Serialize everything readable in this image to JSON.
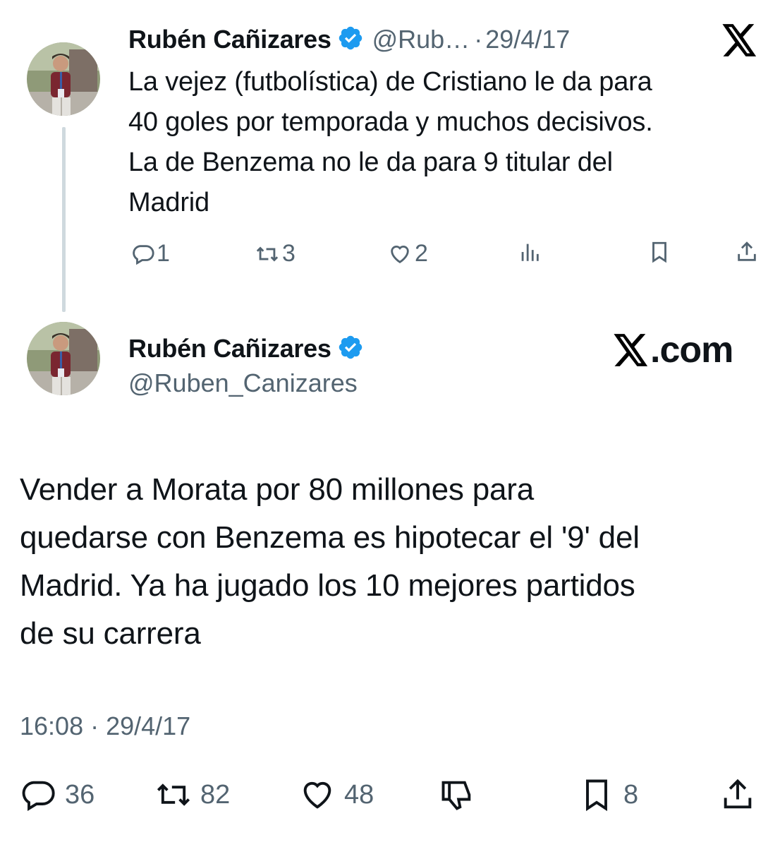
{
  "reply_tweet": {
    "author_name": "Rubén Cañizares",
    "handle_truncated": "@Rub…",
    "separator": "·",
    "date": "29/4/17",
    "text": "La vejez (futbolística) de Cristiano le da para\n40 goles por temporada y muchos decisivos.\nLa de Benzema no le da para 9 titular del\nMadrid",
    "counts": {
      "replies": "1",
      "retweets": "3",
      "likes": "2"
    }
  },
  "main_tweet": {
    "author_name": "Rubén Cañizares",
    "handle": "@Ruben_Canizares",
    "text": "Vender a Morata por 80 millones para\nquedarse con Benzema es hipotecar el '9' del\nMadrid. Ya ha jugado los 10 mejores partidos\nde su carrera",
    "timestamp": "16:08 · 29/4/17",
    "counts": {
      "replies": "36",
      "retweets": "82",
      "likes": "48",
      "bookmarks": "8"
    }
  },
  "watermark": {
    "text": ".com"
  },
  "icons": {
    "verified": "verified-badge-icon",
    "x_logo": "x-logo-icon",
    "reply": "reply-icon",
    "retweet": "retweet-icon",
    "like": "heart-icon",
    "views": "views-icon",
    "bookmark": "bookmark-icon",
    "share": "share-icon",
    "dislike": "thumbs-down-icon"
  },
  "colors": {
    "verified": "#1d9bf0",
    "text": "#0f1419",
    "muted": "#536471",
    "thread_line": "#cfd9de"
  }
}
